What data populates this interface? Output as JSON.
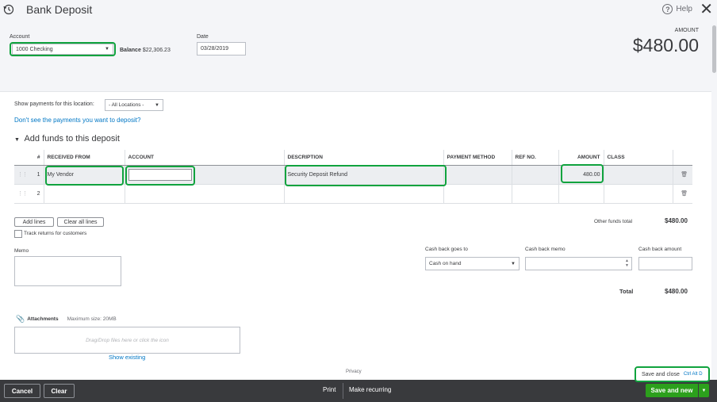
{
  "header": {
    "title": "Bank Deposit",
    "help_label": "Help",
    "account_label": "Account",
    "account_value": "1000 Checking",
    "balance_label": "Balance",
    "balance_value": "$22,306.23",
    "date_label": "Date",
    "date_value": "03/28/2019",
    "amount_label": "AMOUNT",
    "amount_value": "$480.00"
  },
  "filters": {
    "location_label": "Show payments for this location:",
    "location_value": "- All Locations -",
    "missing_link": "Don't see the payments you want to deposit?"
  },
  "funds": {
    "section_title": "Add funds to this deposit",
    "columns": [
      "#",
      "RECEIVED FROM",
      "ACCOUNT",
      "DESCRIPTION",
      "PAYMENT METHOD",
      "REF NO.",
      "AMOUNT",
      "CLASS"
    ],
    "rows": [
      {
        "num": "1",
        "received_from": "My Vendor",
        "account": "",
        "description": "Security Deposit Refund",
        "payment_method": "",
        "ref_no": "",
        "amount": "480.00",
        "class": ""
      },
      {
        "num": "2",
        "received_from": "",
        "account": "",
        "description": "",
        "payment_method": "",
        "ref_no": "",
        "amount": "",
        "class": ""
      }
    ],
    "add_lines": "Add lines",
    "clear_lines": "Clear all lines",
    "track_returns": "Track returns for customers",
    "other_total_label": "Other funds total",
    "other_total_value": "$480.00"
  },
  "memo": {
    "label": "Memo"
  },
  "cashback": {
    "goes_to_label": "Cash back goes to",
    "goes_to_value": "Cash on hand",
    "memo_label": "Cash back memo",
    "amount_label": "Cash back amount",
    "total_label": "Total",
    "total_value": "$480.00"
  },
  "attachments": {
    "label": "Attachments",
    "max_size": "Maximum size: 20MB",
    "drop_text": "Drag/Drop files here or click the icon",
    "show_existing": "Show existing"
  },
  "privacy": "Privacy",
  "footer": {
    "cancel": "Cancel",
    "clear": "Clear",
    "print": "Print",
    "make_recurring": "Make recurring",
    "save_and_new": "Save and new",
    "save_and_close": "Save and close",
    "save_close_shortcut": "Ctrl Alt D"
  },
  "colors": {
    "accent_green": "#2ca01c",
    "highlight_green": "#10a33e",
    "link_blue": "#0077c5",
    "footer_bg": "#393a3d"
  },
  "icons": [
    "history-icon",
    "help-icon",
    "close-icon",
    "paperclip-icon",
    "trash-icon",
    "drag-handle-icon"
  ]
}
